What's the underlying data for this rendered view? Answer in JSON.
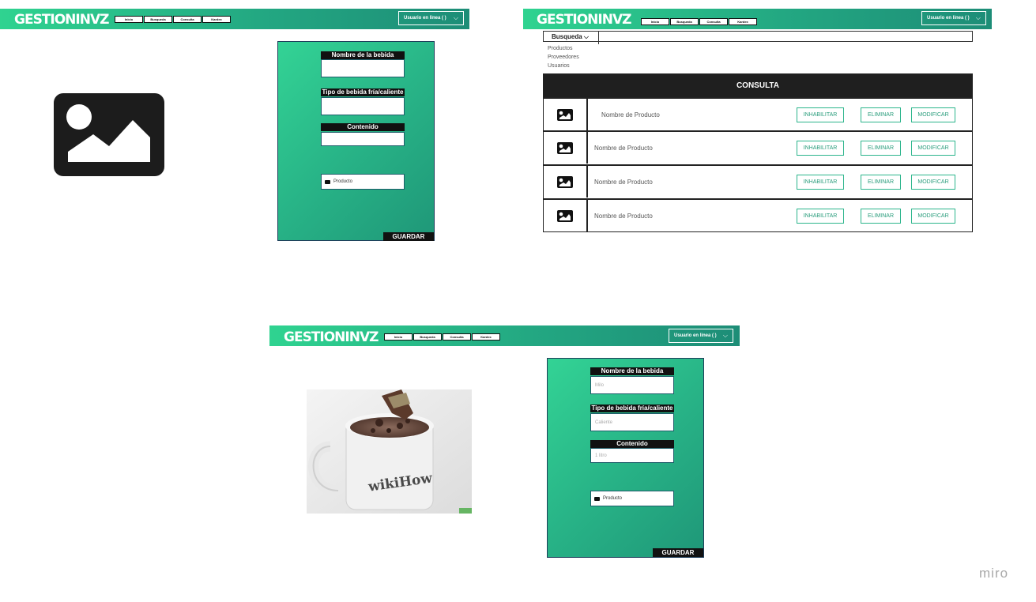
{
  "app": {
    "logo": "GESTIONINVZ",
    "nav": [
      "Inicio",
      "Busqueda",
      "Consulta",
      "Kardex"
    ],
    "user_label": "Usuario en linea ( )"
  },
  "form_empty": {
    "labels": [
      "Nombre de la bebida",
      "Tipo de bebida fría/caliente",
      "Contenido"
    ],
    "values": [
      "",
      "",
      ""
    ],
    "product_label": "Producto",
    "save_label": "GUARDAR"
  },
  "consulta": {
    "dropdown_label": "Busqueda",
    "menu_items": [
      "Productos",
      "Proveedores",
      "Usuarios"
    ],
    "table_title": "CONSULTA",
    "rows": [
      {
        "name": "Nombre de Producto"
      },
      {
        "name": "Nombre de Producto"
      },
      {
        "name": "Nombre de Producto"
      },
      {
        "name": "Nombre de Producto"
      }
    ],
    "actions": [
      "INHABILITAR",
      "ELIMINAR",
      "MODIFICAR"
    ]
  },
  "form_filled": {
    "labels": [
      "Nombre de la bebida",
      "Tipo de bebida fría/caliente",
      "Contenido"
    ],
    "values": [
      "Milo",
      "Caliente",
      "1 litro"
    ],
    "product_label": "Producto",
    "save_label": "GUARDAR"
  },
  "photo": {
    "mug_text": "wikiHow"
  },
  "watermark": "miro",
  "colors": {
    "header_start": "#2fd390",
    "header_end": "#1d8d77",
    "accent": "#2cb58c",
    "dark": "#111111"
  }
}
